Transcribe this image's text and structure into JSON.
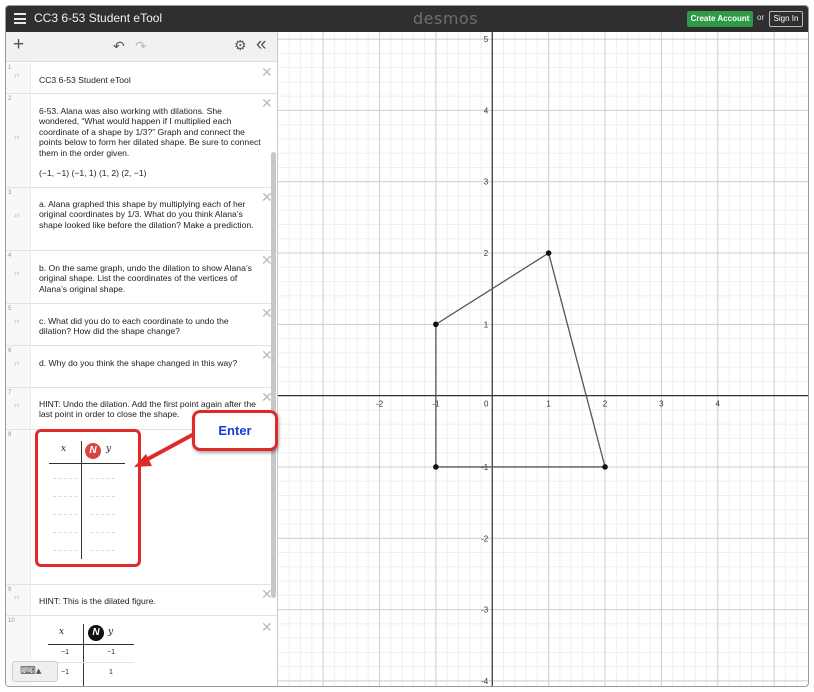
{
  "app": {
    "title": "CC3 6-53 Student eTool",
    "logo": "desmos",
    "create_account": "Create Account",
    "or": "or",
    "sign_in": "Sign In"
  },
  "icons": {
    "menu": "≡",
    "add": "+",
    "undo": "↶",
    "redo": "↷",
    "settings": "⚙",
    "collapse": "«",
    "quote": "“",
    "close": "✕",
    "keyboard": "⌨▴",
    "regression": "N"
  },
  "expressions": [
    {
      "num": "1",
      "text": "CC3 6-53 Student eTool"
    },
    {
      "num": "2",
      "text": "6-53. Alana was also working with dilations. She wondered, “What would happen if I multiplied each coordinate of a shape by 1/3?” Graph and connect the points below to form her dilated shape. Be sure to connect them in the order given.",
      "text2": "(−1, −1) (−1, 1) (1, 2) (2, −1)"
    },
    {
      "num": "3",
      "text": "a. Alana graphed this shape by multiplying each of her original coordinates by 1/3. What do you think Alana’s shape looked like before the dilation? Make a prediction."
    },
    {
      "num": "4",
      "text": "b. On the same graph, undo the dilation to show Alana’s original shape. List the coordinates of the vertices of Alana’s original shape."
    },
    {
      "num": "5",
      "text": "c. What did you do to each coordinate to undo the dilation? How did the shape change?"
    },
    {
      "num": "6",
      "text": "d. Why do you think the shape changed in this way?"
    },
    {
      "num": "7",
      "text": "HINT: Undo the dilation. Add the first point again after the last point in order to close the shape."
    },
    {
      "num": "8"
    },
    {
      "num": "9",
      "text": "HINT: This is the dilated figure."
    },
    {
      "num": "10"
    }
  ],
  "table_empty": {
    "x_header": "x",
    "y_header": "y",
    "row_count": 5
  },
  "table_dilated": {
    "x_header": "x",
    "y_header": "y",
    "rows": [
      [
        "−1",
        "−1"
      ],
      [
        "−1",
        "1"
      ]
    ]
  },
  "callout": {
    "label": "Enter"
  },
  "graph": {
    "x_range": [
      -3.8,
      5.6
    ],
    "y_range": [
      -4.1,
      5.1
    ],
    "x_ticks": [
      "-2",
      "-1",
      "0",
      "1",
      "2",
      "3",
      "4"
    ],
    "y_ticks": [
      "-4",
      "-3",
      "-2",
      "-1",
      "1",
      "2",
      "3",
      "4",
      "5"
    ],
    "polygon": [
      [
        -1,
        -1
      ],
      [
        -1,
        1
      ],
      [
        1,
        2
      ],
      [
        2,
        -1
      ]
    ]
  },
  "colors": {
    "accent_red": "#e02a2a",
    "create_green": "#2f9a45",
    "enter_blue": "#1a3bd6",
    "topbar": "#2f2f2f"
  }
}
